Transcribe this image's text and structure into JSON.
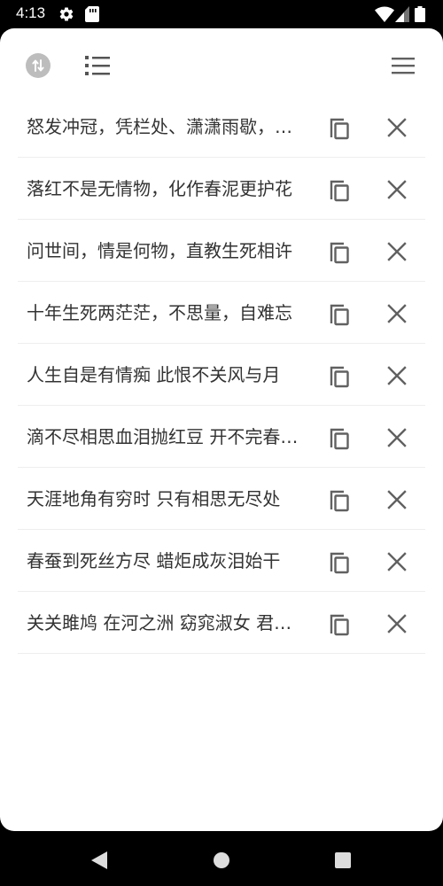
{
  "status_bar": {
    "time": "4:13",
    "icons": [
      "gear-icon",
      "sd-card-icon",
      "wifi-icon",
      "cellular-signal-icon",
      "battery-icon"
    ]
  },
  "toolbar": {
    "left_icons": [
      "sort-circle-icon",
      "list-icon"
    ],
    "right_icons": [
      "menu-icon"
    ]
  },
  "clips": [
    {
      "text": "怒发冲冠，凭栏处、潇潇雨歇，抬望眼、仰天长啸，壮怀激烈"
    },
    {
      "text": "落红不是无情物，化作春泥更护花"
    },
    {
      "text": "问世间，情是何物，直教生死相许"
    },
    {
      "text": "十年生死两茫茫，不思量，自难忘"
    },
    {
      "text": "人生自是有情痴 此恨不关风与月"
    },
    {
      "text": "滴不尽相思血泪抛红豆 开不完春柳春花满画楼"
    },
    {
      "text": "天涯地角有穷时 只有相思无尽处"
    },
    {
      "text": "春蚕到死丝方尽 蜡炬成灰泪始干"
    },
    {
      "text": "关关雎鸠 在河之洲 窈窕淑女 君子好逑"
    }
  ],
  "item_icons": {
    "copy": "copy-icon",
    "delete": "close-icon"
  },
  "nav": {
    "icons": [
      "back-icon",
      "home-icon",
      "recents-icon"
    ]
  },
  "colors": {
    "text": "#333333",
    "icon": "#616161",
    "divider": "#eeeeee",
    "badge": "#bdbdbd"
  }
}
